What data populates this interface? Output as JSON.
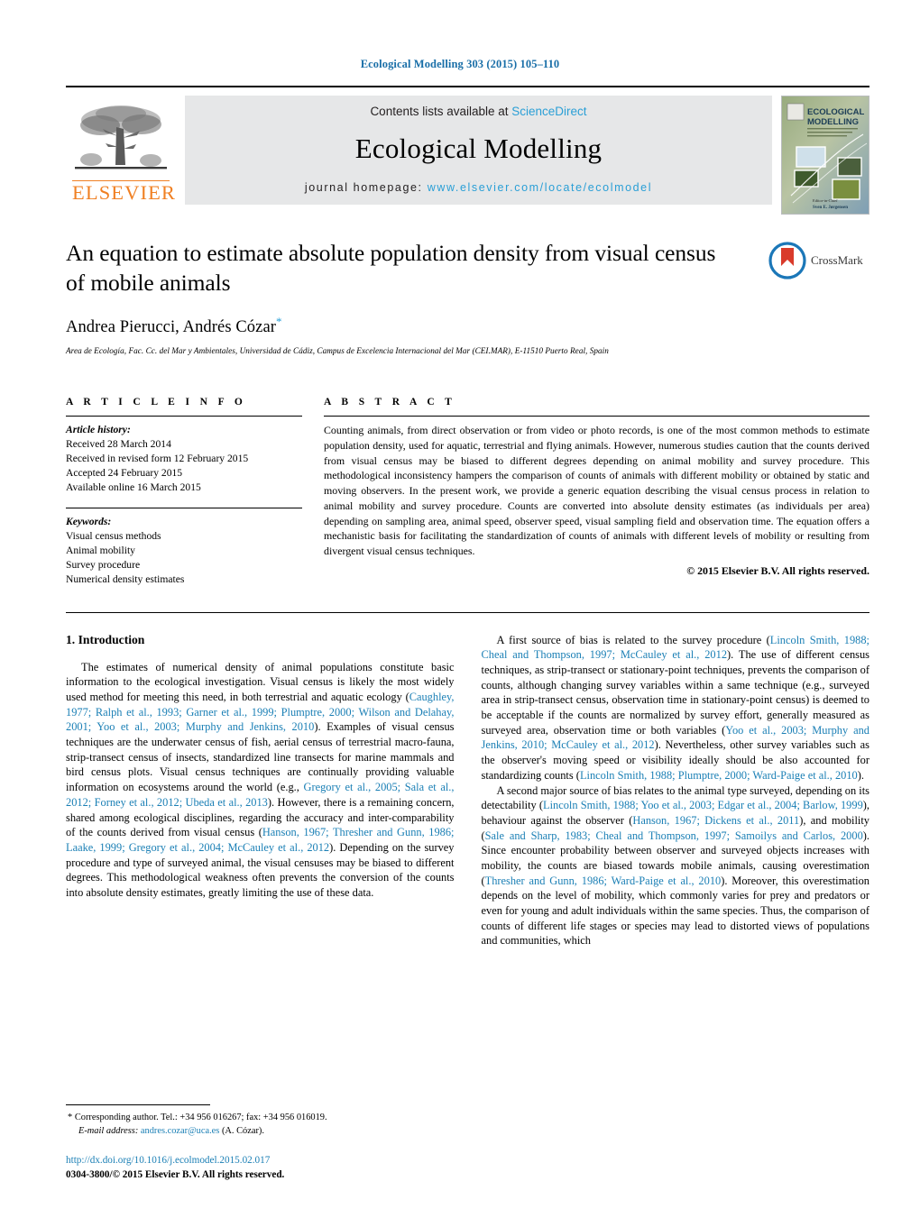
{
  "running_head": "Ecological Modelling 303 (2015) 105–110",
  "masthead": {
    "publisher_name": "ELSEVIER",
    "contents_prefix": "Contents lists available at ",
    "contents_link": "ScienceDirect",
    "journal_name": "Ecological Modelling",
    "homepage_prefix": "journal homepage: ",
    "homepage_url": "www.elsevier.com/locate/ecolmodel",
    "cover_title_line1": "ECOLOGICAL",
    "cover_title_line2": "MODELLING"
  },
  "article": {
    "title": "An equation to estimate absolute population density from visual census of mobile animals",
    "authors": "Andrea Pierucci, Andrés Cózar",
    "corresponding_marker": "*",
    "affiliation": "Area de Ecología, Fac. Cc. del Mar y Ambientales, Universidad de Cádiz, Campus de Excelencia Internacional del Mar (CEI.MAR), E-11510 Puerto Real, Spain",
    "crossmark_label": "CrossMark"
  },
  "article_info": {
    "heading": "A R T I C L E  I N F O",
    "history_label": "Article history:",
    "history": [
      "Received 28 March 2014",
      "Received in revised form 12 February 2015",
      "Accepted 24 February 2015",
      "Available online 16 March 2015"
    ],
    "keywords_label": "Keywords:",
    "keywords": [
      "Visual census methods",
      "Animal mobility",
      "Survey procedure",
      "Numerical density estimates"
    ]
  },
  "abstract": {
    "heading": "A B S T R A C T",
    "text": "Counting animals, from direct observation or from video or photo records, is one of the most common methods to estimate population density, used for aquatic, terrestrial and flying animals. However, numerous studies caution that the counts derived from visual census may be biased to different degrees depending on animal mobility and survey procedure. This methodological inconsistency hampers the comparison of counts of animals with different mobility or obtained by static and moving observers. In the present work, we provide a generic equation describing the visual census process in relation to animal mobility and survey procedure. Counts are converted into absolute density estimates (as individuals per area) depending on sampling area, animal speed, observer speed, visual sampling field and observation time. The equation offers a mechanistic basis for facilitating the standardization of counts of animals with different levels of mobility or resulting from divergent visual census techniques.",
    "copyright": "© 2015 Elsevier B.V. All rights reserved."
  },
  "introduction": {
    "heading": "1.  Introduction",
    "left_paragraph_1_a": "The estimates of numerical density of animal populations constitute basic information to the ecological investigation. Visual census is likely the most widely used method for meeting this need, in both terrestrial and aquatic ecology (",
    "left_paragraph_1_ref1": "Caughley, 1977; Ralph et al., 1993; Garner et al., 1999; Plumptre, 2000; Wilson and Delahay, 2001; Yoo et al., 2003; Murphy and Jenkins, 2010",
    "left_paragraph_1_b": "). Examples of visual census techniques are the underwater census of fish, aerial census of terrestrial macro-fauna, strip-transect census of insects, standardized line transects for marine mammals and bird census plots. Visual census techniques are continually providing valuable information on ecosystems around the world (e.g., ",
    "left_paragraph_1_ref2": "Gregory et al., 2005; Sala et al., 2012; Forney et al., 2012; Ubeda et al., 2013",
    "left_paragraph_1_c": "). However, there is a remaining concern, shared among ecological disciplines, regarding the accuracy and inter-comparability of the counts derived from visual census (",
    "left_paragraph_1_ref3": "Hanson, 1967; Thresher and Gunn, 1986; Laake, 1999; Gregory et al., 2004; McCauley et al., 2012",
    "left_paragraph_1_d": "). Depending on the survey procedure and type of surveyed animal, the visual censuses may be biased to different degrees. This methodological weakness often prevents the conversion of the counts into absolute density estimates, greatly limiting the use of these data.",
    "right_paragraph_1_a": "A first source of bias is related to the survey procedure (",
    "right_paragraph_1_ref1": "Lincoln Smith, 1988; Cheal and Thompson, 1997; McCauley et al., 2012",
    "right_paragraph_1_b": "). The use of different census techniques, as strip-transect or stationary-point techniques, prevents the comparison of counts, although changing survey variables within a same technique (e.g., surveyed area in strip-transect census, observation time in stationary-point census) is deemed to be acceptable if the counts are normalized by survey effort, generally measured as surveyed area, observation time or both variables (",
    "right_paragraph_1_ref2": "Yoo et al., 2003; Murphy and Jenkins, 2010; McCauley et al., 2012",
    "right_paragraph_1_c": "). Nevertheless, other survey variables such as the observer's moving speed or visibility ideally should be also accounted for standardizing counts (",
    "right_paragraph_1_ref3": "Lincoln Smith, 1988; Plumptre, 2000; Ward-Paige et al., 2010",
    "right_paragraph_1_d": ").",
    "right_paragraph_2_a": "A second major source of bias relates to the animal type surveyed, depending on its detectability (",
    "right_paragraph_2_ref1": "Lincoln Smith, 1988; Yoo et al., 2003; Edgar et al., 2004; Barlow, 1999",
    "right_paragraph_2_b": "), behaviour against the observer (",
    "right_paragraph_2_ref2": "Hanson, 1967; Dickens et al., 2011",
    "right_paragraph_2_c": "), and mobility (",
    "right_paragraph_2_ref3": "Sale and Sharp, 1983; Cheal and Thompson, 1997; Samoilys and Carlos, 2000",
    "right_paragraph_2_d": "). Since encounter probability between observer and surveyed objects increases with mobility, the counts are biased towards mobile animals, causing overestimation (",
    "right_paragraph_2_ref4": "Thresher and Gunn, 1986; Ward-Paige et al., 2010",
    "right_paragraph_2_e": "). Moreover, this overestimation depends on the level of mobility, which commonly varies for prey and predators or even for young and adult individuals within the same species. Thus, the comparison of counts of different life stages or species may lead to distorted views of populations and communities, which"
  },
  "footnote": {
    "marker": "*",
    "corresponding": "Corresponding author. Tel.: +34 956 016267; fax: +34 956 016019.",
    "email_label": "E-mail address:",
    "email": "andres.cozar@uca.es",
    "email_suffix": "(A. Cózar)."
  },
  "doi_block": {
    "doi_url": "http://dx.doi.org/10.1016/j.ecolmodel.2015.02.017",
    "issn_line": "0304-3800/© 2015 Elsevier B.V. All rights reserved."
  },
  "colors": {
    "link_blue": "#1a7fb5",
    "sciencedirect_blue": "#2a9fd6",
    "elsevier_orange": "#F08023",
    "band_gray": "#e6e7e8"
  }
}
